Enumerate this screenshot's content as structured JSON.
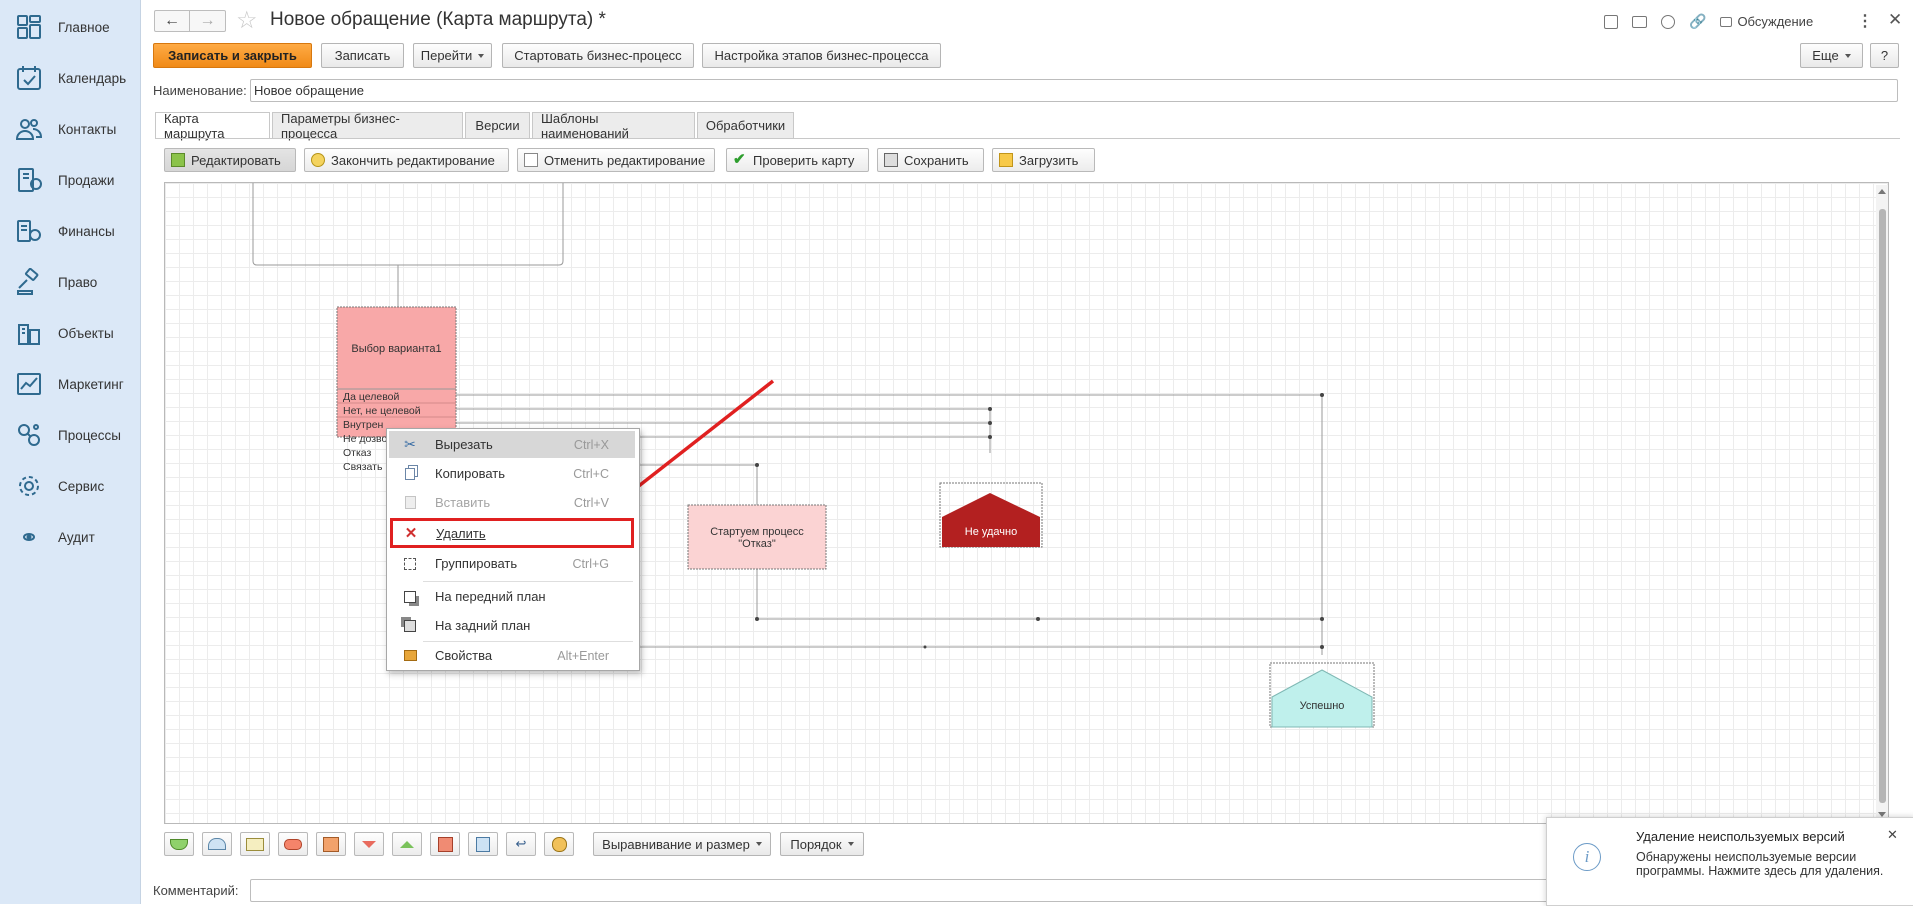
{
  "sidebar": {
    "items": [
      {
        "label": "Главное",
        "icon": "home-grid-icon"
      },
      {
        "label": "Календарь",
        "icon": "calendar-icon"
      },
      {
        "label": "Контакты",
        "icon": "contacts-icon"
      },
      {
        "label": "Продажи",
        "icon": "sales-icon"
      },
      {
        "label": "Финансы",
        "icon": "finance-icon"
      },
      {
        "label": "Право",
        "icon": "gavel-icon"
      },
      {
        "label": "Объекты",
        "icon": "buildings-icon"
      },
      {
        "label": "Маркетинг",
        "icon": "chart-icon"
      },
      {
        "label": "Процессы",
        "icon": "processes-icon"
      },
      {
        "label": "Сервис",
        "icon": "gear-icon"
      },
      {
        "label": "Аудит",
        "icon": "eye-icon"
      }
    ]
  },
  "header": {
    "title": "Новое обращение (Карта маршрута) *",
    "discussion_label": "Обсуждение"
  },
  "command_bar": {
    "save_close": "Записать и закрыть",
    "save": "Записать",
    "goto": "Перейти",
    "start_bp": "Стартовать бизнес-процесс",
    "bp_stages": "Настройка этапов бизнес-процесса",
    "more": "Еще",
    "help": "?"
  },
  "name_field": {
    "label": "Наименование:",
    "value": "Новое обращение"
  },
  "tabs": [
    {
      "label": "Карта маршрута",
      "active": true
    },
    {
      "label": "Параметры бизнес-процесса",
      "active": false
    },
    {
      "label": "Версии",
      "active": false
    },
    {
      "label": "Шаблоны наименований",
      "active": false
    },
    {
      "label": "Обработчики",
      "active": false
    }
  ],
  "map_toolbar": {
    "edit": "Редактировать",
    "finish_edit": "Закончить редактирование",
    "cancel_edit": "Отменить редактирование",
    "check_map": "Проверить карту",
    "save": "Сохранить",
    "load": "Загрузить"
  },
  "map": {
    "choice_block": {
      "title": "Выбор варианта1",
      "options": [
        "Да целевой",
        "Нет, не целевой",
        "Внутрен",
        "Не дозво",
        "Отказ",
        "Связать"
      ]
    },
    "start_process": {
      "line1": "Стартуем процесс",
      "line2": "\"Отказ\""
    },
    "fail_end": "Не удачно",
    "success_end": "Успешно"
  },
  "context_menu": {
    "items": [
      {
        "label": "Вырезать",
        "shortcut": "Ctrl+X",
        "icon": "scissors-icon"
      },
      {
        "label": "Копировать",
        "shortcut": "Ctrl+C",
        "icon": "copy-icon"
      },
      {
        "label": "Вставить",
        "shortcut": "Ctrl+V",
        "icon": "paste-icon"
      },
      {
        "label": "Удалить",
        "shortcut": "",
        "icon": "delete-x-icon"
      },
      {
        "label": "Группировать",
        "shortcut": "Ctrl+G",
        "icon": "group-icon"
      },
      {
        "label": "На передний план",
        "shortcut": "",
        "icon": "bring-front-icon"
      },
      {
        "label": "На задний план",
        "shortcut": "",
        "icon": "send-back-icon"
      },
      {
        "label": "Свойства",
        "shortcut": "Alt+Enter",
        "icon": "properties-icon"
      }
    ]
  },
  "bottom_bar": {
    "align_size": "Выравнивание и размер",
    "order": "Порядок"
  },
  "comment": {
    "label": "Комментарий:",
    "value": ""
  },
  "notification": {
    "title": "Удаление неиспользуемых версий",
    "text": "Обнаружены неиспользуемые версии программы. Нажмите здесь для удаления."
  },
  "colors": {
    "accent_orange": "#f39a2b",
    "highlight_red": "#e02020",
    "choice_fill": "#f8a8a8",
    "fail_fill": "#b32020",
    "success_fill": "#bff0ec",
    "start_fill": "#fbd3d3"
  }
}
